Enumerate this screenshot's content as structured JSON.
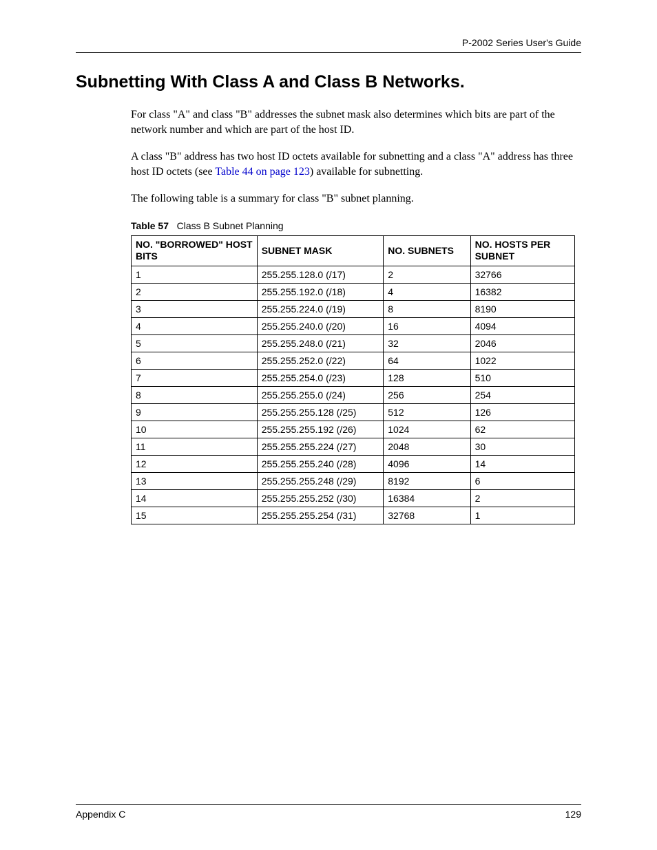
{
  "header": {
    "guide_title": "P-2002 Series User's Guide"
  },
  "section": {
    "title": "Subnetting With Class A and Class B Networks.",
    "para1": "For class \"A\" and class \"B\" addresses the subnet mask also determines which bits are part of the network number and which are part of the host ID.",
    "para2_pre": "A class \"B\" address has two host ID octets available for subnetting and a class \"A\" address has three host ID octets (see ",
    "para2_link": "Table 44 on page 123",
    "para2_post": ") available for subnetting.",
    "para3": "The following table is a summary for class \"B\" subnet planning."
  },
  "table": {
    "caption_label": "Table 57",
    "caption_text": "Class B Subnet Planning",
    "headers": {
      "bits": "NO. \"BORROWED\" HOST BITS",
      "mask": "SUBNET MASK",
      "subnets": "NO. SUBNETS",
      "hosts": "NO. HOSTS PER SUBNET"
    },
    "rows": [
      {
        "bits": "1",
        "mask": "255.255.128.0 (/17)",
        "subnets": "2",
        "hosts": "32766"
      },
      {
        "bits": "2",
        "mask": "255.255.192.0 (/18)",
        "subnets": "4",
        "hosts": "16382"
      },
      {
        "bits": "3",
        "mask": "255.255.224.0 (/19)",
        "subnets": "8",
        "hosts": "8190"
      },
      {
        "bits": "4",
        "mask": "255.255.240.0 (/20)",
        "subnets": "16",
        "hosts": "4094"
      },
      {
        "bits": "5",
        "mask": "255.255.248.0 (/21)",
        "subnets": "32",
        "hosts": "2046"
      },
      {
        "bits": "6",
        "mask": "255.255.252.0 (/22)",
        "subnets": "64",
        "hosts": "1022"
      },
      {
        "bits": "7",
        "mask": "255.255.254.0 (/23)",
        "subnets": "128",
        "hosts": "510"
      },
      {
        "bits": "8",
        "mask": "255.255.255.0 (/24)",
        "subnets": "256",
        "hosts": "254"
      },
      {
        "bits": "9",
        "mask": "255.255.255.128 (/25)",
        "subnets": "512",
        "hosts": "126"
      },
      {
        "bits": "10",
        "mask": "255.255.255.192 (/26)",
        "subnets": "1024",
        "hosts": "62"
      },
      {
        "bits": "11",
        "mask": "255.255.255.224 (/27)",
        "subnets": "2048",
        "hosts": "30"
      },
      {
        "bits": "12",
        "mask": "255.255.255.240 (/28)",
        "subnets": "4096",
        "hosts": "14"
      },
      {
        "bits": "13",
        "mask": "255.255.255.248 (/29)",
        "subnets": "8192",
        "hosts": "6"
      },
      {
        "bits": "14",
        "mask": "255.255.255.252 (/30)",
        "subnets": "16384",
        "hosts": "2"
      },
      {
        "bits": "15",
        "mask": "255.255.255.254 (/31)",
        "subnets": "32768",
        "hosts": "1"
      }
    ]
  },
  "footer": {
    "left": "Appendix C",
    "right": "129"
  }
}
